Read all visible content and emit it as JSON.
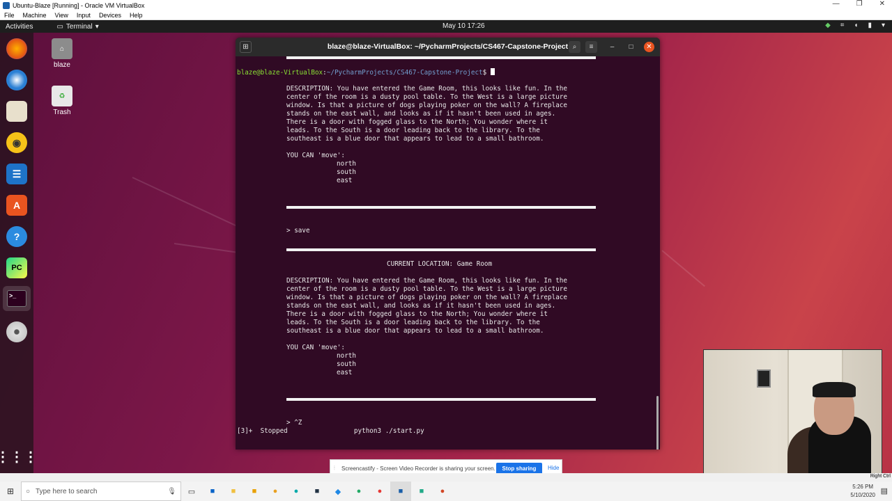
{
  "vbox": {
    "title": "Ubuntu-Blaze [Running] - Oracle VM VirtualBox",
    "menu": [
      "File",
      "Machine",
      "View",
      "Input",
      "Devices",
      "Help"
    ],
    "status_right": "Right Ctrl"
  },
  "topbar": {
    "activities": "Activities",
    "app_menu": "Terminal",
    "clock": "May 10  17:26"
  },
  "desktop_icons": [
    {
      "label": "blaze"
    },
    {
      "label": "Trash"
    }
  ],
  "dock": [
    {
      "name": "firefox"
    },
    {
      "name": "thunderbird"
    },
    {
      "name": "files"
    },
    {
      "name": "rhythmbox"
    },
    {
      "name": "libreoffice-writer"
    },
    {
      "name": "ubuntu-software"
    },
    {
      "name": "help"
    },
    {
      "name": "pycharm"
    },
    {
      "name": "terminal"
    },
    {
      "name": "dvd"
    },
    {
      "name": "show-applications"
    }
  ],
  "terminal": {
    "title": "blaze@blaze-VirtualBox: ~/PycharmProjects/CS467-Capstone-Project",
    "prompt_user": "blaze@blaze-VirtualBox",
    "prompt_sep": ":",
    "prompt_path": "~/PycharmProjects/CS467-Capstone-Project",
    "prompt_end": "$ ",
    "block1": {
      "description": [
        "DESCRIPTION: You have entered the Game Room, this looks like fun. In the",
        "center of the room is a dusty pool table. To the West is a large picture",
        "window. Is that a picture of dogs playing poker on the wall? A fireplace",
        "stands on the east wall, and looks as if it hasn't been used in ages.",
        "There is a door with fogged glass to the North; You wonder where it",
        "leads. To the South is a door leading back to the library. To the",
        "southeast is a blue door that appears to lead to a small bathroom."
      ],
      "can_move": "YOU CAN 'move':",
      "moves": [
        "north",
        "south",
        "east"
      ]
    },
    "command1": "> save",
    "location": "CURRENT LOCATION: Game Room",
    "block2": {
      "description": [
        "DESCRIPTION: You have entered the Game Room, this looks like fun. In the",
        "center of the room is a dusty pool table. To the West is a large picture",
        "window. Is that a picture of dogs playing poker on the wall? A fireplace",
        "stands on the east wall, and looks as if it hasn't been used in ages.",
        "There is a door with fogged glass to the North; You wonder where it",
        "leads. To the South is a door leading back to the library. To the",
        "southeast is a blue door that appears to lead to a small bathroom."
      ],
      "can_move": "YOU CAN 'move':",
      "moves": [
        "north",
        "south",
        "east"
      ]
    },
    "command2": "> ^Z",
    "job_line": "[3]+  Stopped                 python3 ./start.py"
  },
  "screencastify": {
    "message": "Screencastify - Screen Video Recorder is sharing your screen.",
    "stop": "Stop sharing",
    "hide": "Hide"
  },
  "taskbar": {
    "search_placeholder": "Type here to search",
    "time": "5:26 PM",
    "date": "5/10/2020"
  },
  "colors": {
    "terminal_bg": "#300a24",
    "prompt_user": "#8ae234",
    "prompt_path": "#729fcf",
    "close_button": "#e95420"
  }
}
